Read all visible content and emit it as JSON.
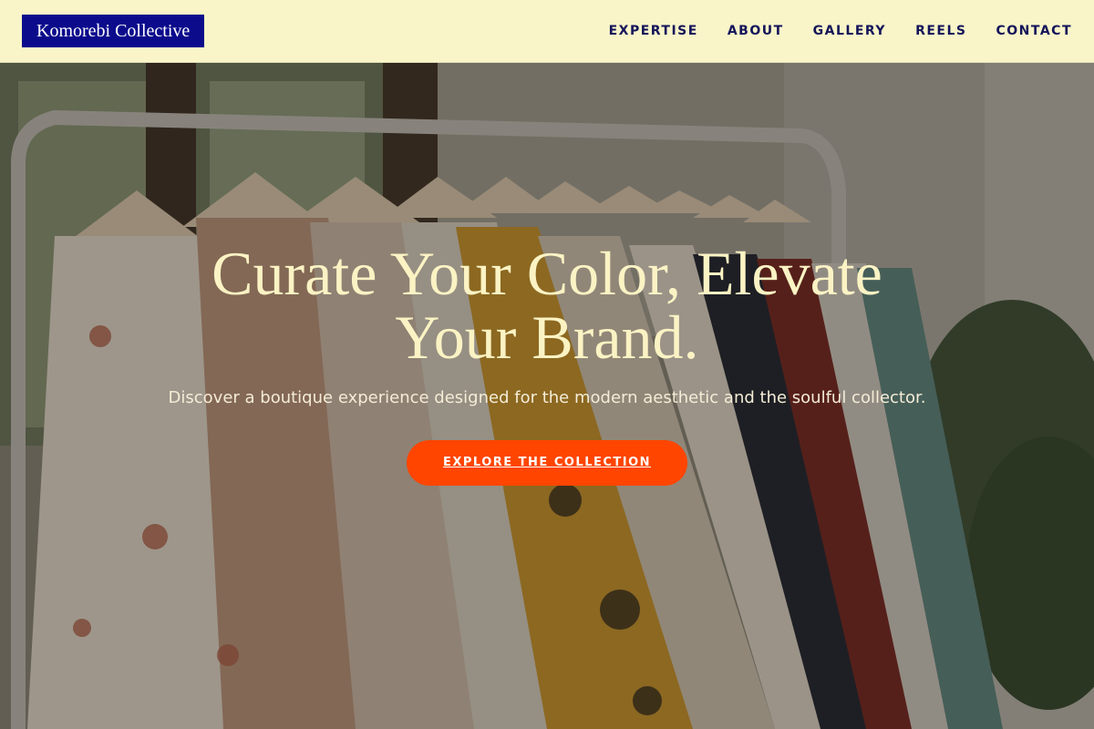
{
  "header": {
    "logo_text": "Komorebi Collective",
    "nav": [
      {
        "label": "EXPERTISE"
      },
      {
        "label": "ABOUT"
      },
      {
        "label": "GALLERY"
      },
      {
        "label": "REELS"
      },
      {
        "label": "CONTACT"
      }
    ]
  },
  "hero": {
    "title": "Curate Your Color, Elevate Your Brand.",
    "subtitle": "Discover a boutique experience designed for the modern aesthetic and the soulful collector.",
    "cta_label": "EXPLORE THE COLLECTION",
    "background_image": "clothing-rack-photo"
  },
  "colors": {
    "header_bg": "#f9f5c9",
    "logo_bg": "#0b0b8c",
    "nav_text": "#14145a",
    "hero_title": "#fbf3c4",
    "cta_bg": "#ff4500"
  }
}
